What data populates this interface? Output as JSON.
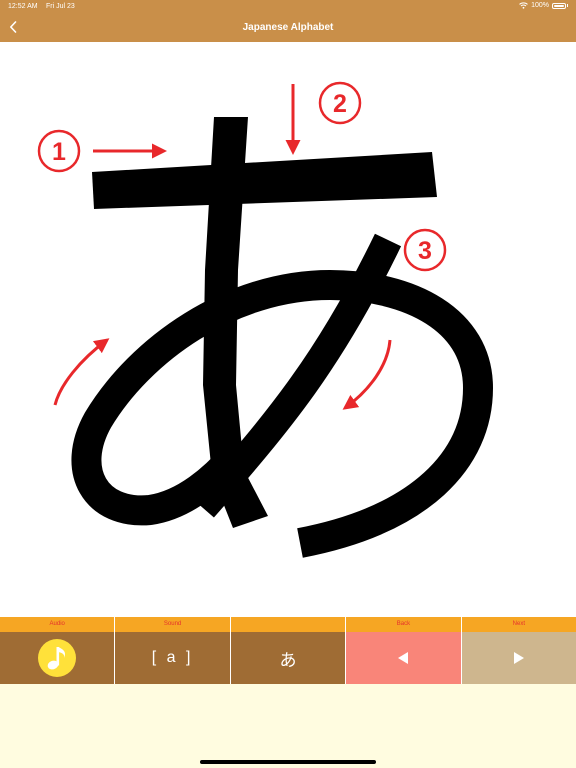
{
  "status_bar": {
    "time": "12:52 AM",
    "date": "Fri Jul 23",
    "battery": "100%"
  },
  "nav": {
    "title": "Japanese Alphabet",
    "back_icon": "chevron-left-icon"
  },
  "stroke_diagram": {
    "character": "あ",
    "stroke_numbers": [
      "①",
      "②",
      "③"
    ],
    "accent_color": "#e8282b"
  },
  "toolbar": {
    "items": [
      {
        "label": "Audio",
        "icon": "music-note-icon"
      },
      {
        "label": "Sound",
        "text": "[ a ]"
      },
      {
        "label": "",
        "text": "あ"
      },
      {
        "label": "Back",
        "icon": "triangle-left-icon"
      },
      {
        "label": "Next",
        "icon": "triangle-right-icon"
      }
    ]
  },
  "colors": {
    "header": "#c98f49",
    "label_strip": "#f6a623",
    "label_text": "#e5322d",
    "tool_brown": "#9f6c34",
    "back_pink": "#f98579",
    "next_tan": "#ceb68e",
    "audio_yellow": "#ffe13a",
    "bottom_bg": "#fffce0"
  }
}
